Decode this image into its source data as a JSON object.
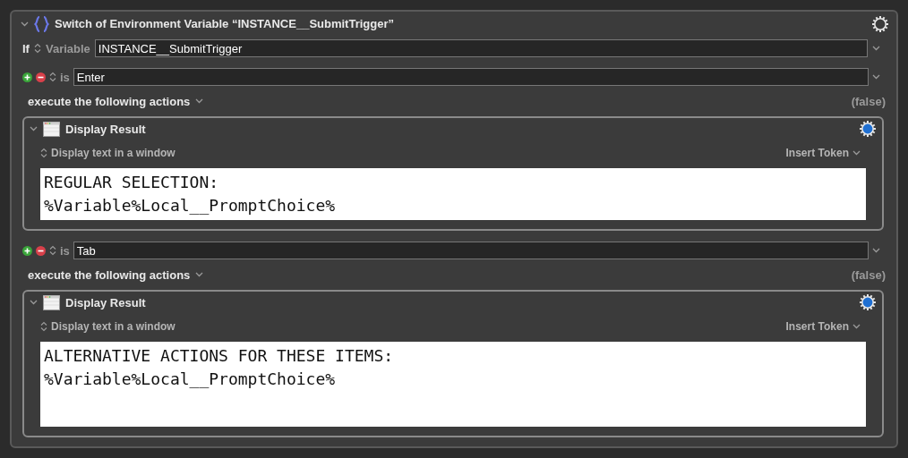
{
  "switch": {
    "title": "Switch of Environment Variable “INSTANCE__SubmitTrigger”",
    "if_label": "If",
    "source": "Variable",
    "variable": "INSTANCE__SubmitTrigger",
    "cases": [
      {
        "operator": "is",
        "value": "Enter",
        "execute_label": "execute the following actions",
        "result": "(false)",
        "actions": [
          {
            "title": "Display Result",
            "mode": "Display text in a window",
            "token_menu": "Insert Token",
            "text": "REGULAR SELECTION:\n%Variable%Local__PromptChoice%"
          }
        ]
      },
      {
        "operator": "is",
        "value": "Tab",
        "execute_label": "execute the following actions",
        "result": "(false)",
        "actions": [
          {
            "title": "Display Result",
            "mode": "Display text in a window",
            "token_menu": "Insert Token",
            "text": "ALTERNATIVE ACTIONS FOR THESE ITEMS:\n%Variable%Local__PromptChoice%"
          }
        ]
      }
    ]
  }
}
